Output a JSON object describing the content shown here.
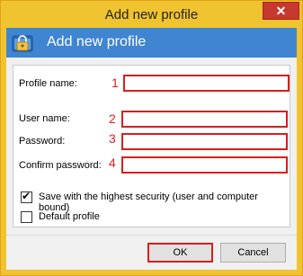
{
  "window": {
    "title": "Add new profile",
    "close_symbol": "✕"
  },
  "header": {
    "title": "Add new profile",
    "icon": "lock-folder-icon"
  },
  "form": {
    "profile_name": {
      "label": "Profile name:",
      "value": "",
      "step": "1"
    },
    "user_name": {
      "label": "User name:",
      "value": "",
      "step": "2"
    },
    "password": {
      "label": "Password:",
      "value": "",
      "step": "3"
    },
    "confirm_password": {
      "label": "Confirm password:",
      "value": "",
      "step": "4"
    }
  },
  "options": {
    "highest_security": {
      "label": "Save with the highest security (user and computer bound)",
      "checked": true,
      "tick": "✔"
    },
    "default_profile": {
      "label": "Default profile",
      "checked": false
    }
  },
  "buttons": {
    "ok": "OK",
    "cancel": "Cancel"
  },
  "colors": {
    "titlebar": "#f0c330",
    "header": "#3f85d1",
    "highlight": "#d81e1e",
    "step_number": "#e02020"
  }
}
